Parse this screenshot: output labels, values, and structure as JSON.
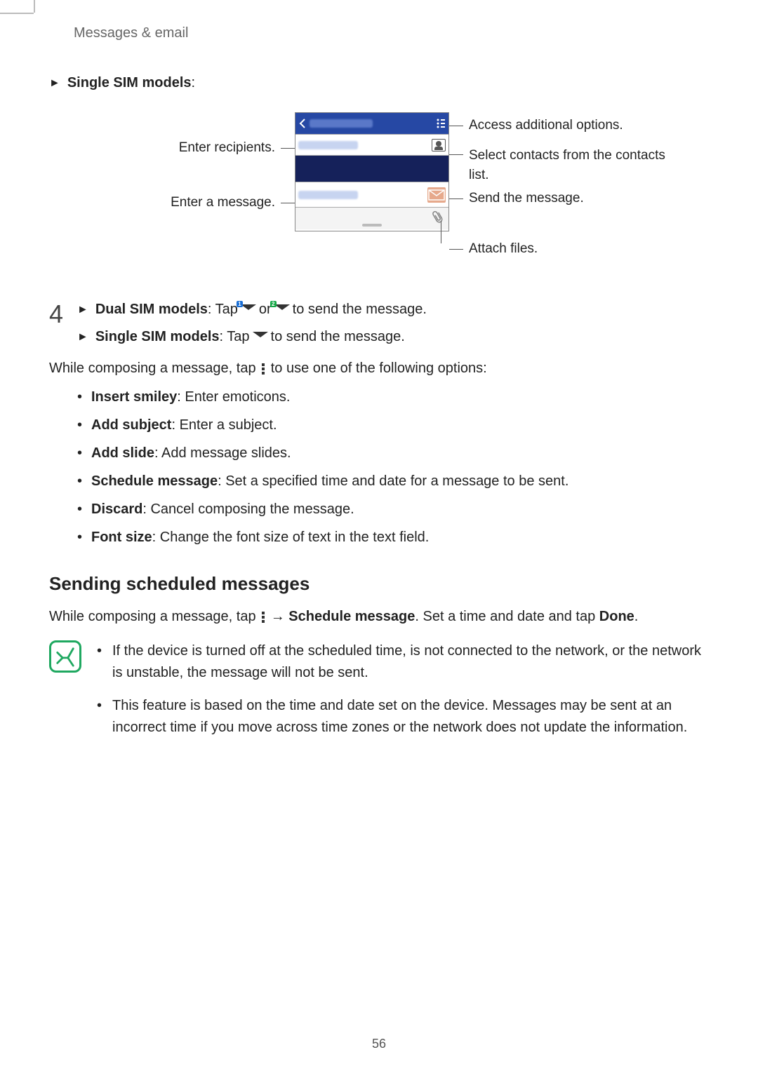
{
  "header": {
    "section": "Messages & email"
  },
  "intro": {
    "single_sim_label": "Single SIM models",
    "colon": ":"
  },
  "diagram": {
    "left": {
      "recipients": "Enter recipients.",
      "message": "Enter a message."
    },
    "right": {
      "options": "Access additional options.",
      "contacts": "Select contacts from the contacts list.",
      "send": "Send the message.",
      "attach": "Attach files."
    }
  },
  "step4": {
    "number": "4",
    "dual_label": "Dual SIM models",
    "dual_pre": ": Tap ",
    "or": " or ",
    "dual_post": " to send the message.",
    "single_label": "Single SIM models",
    "single_pre": ": Tap ",
    "single_post": " to send the message."
  },
  "compose_para": {
    "pre": "While composing a message, tap ",
    "post": " to use one of the following options:"
  },
  "options": [
    {
      "title": "Insert smiley",
      "desc": ": Enter emoticons."
    },
    {
      "title": "Add subject",
      "desc": ": Enter a subject."
    },
    {
      "title": "Add slide",
      "desc": ": Add message slides."
    },
    {
      "title": "Schedule message",
      "desc": ": Set a specified time and date for a message to be sent."
    },
    {
      "title": "Discard",
      "desc": ": Cancel composing the message."
    },
    {
      "title": "Font size",
      "desc": ": Change the font size of text in the text field."
    }
  ],
  "scheduled": {
    "heading": "Sending scheduled messages",
    "pre": "While composing a message, tap ",
    "arrow": " → ",
    "link": "Schedule message",
    "mid": ". Set a time and date and tap ",
    "done": "Done",
    "end": "."
  },
  "notes": [
    "If the device is turned off at the scheduled time, is not connected to the network, or the network is unstable, the message will not be sent.",
    "This feature is based on the time and date set on the device. Messages may be sent at an incorrect time if you move across time zones or the network does not update the information."
  ],
  "page_number": "56"
}
